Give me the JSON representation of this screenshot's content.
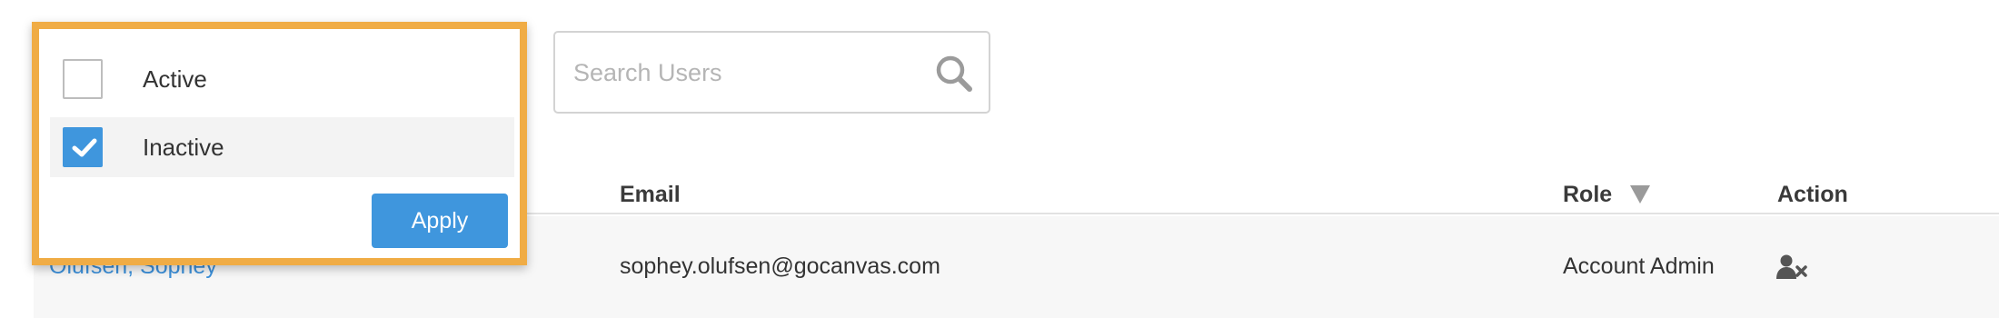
{
  "filter": {
    "options": [
      {
        "label": "Active",
        "checked": false
      },
      {
        "label": "Inactive",
        "checked": true
      }
    ],
    "apply_label": "Apply",
    "border_color": "#f0ac45",
    "accent_color": "#3f96dd"
  },
  "search": {
    "placeholder": "Search Users",
    "value": "",
    "icon": "search-icon"
  },
  "table": {
    "columns": {
      "email": "Email",
      "role": "Role",
      "action": "Action"
    },
    "sort_icon": "sort-down-icon",
    "rows": [
      {
        "name": "Olufsen, Sophey",
        "email": "sophey.olufsen@gocanvas.com",
        "role": "Account Admin",
        "action_icon": "remove-user-icon"
      }
    ]
  }
}
